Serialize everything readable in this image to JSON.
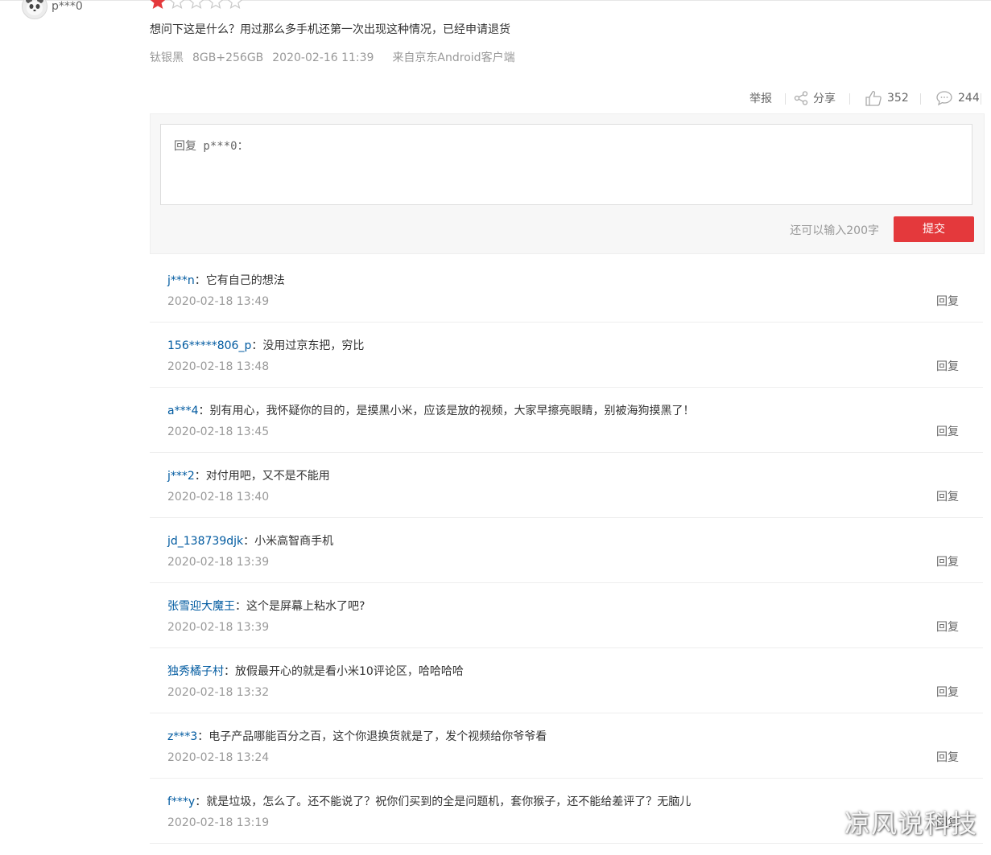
{
  "review": {
    "username": "p***0",
    "rating": 1,
    "rating_max": 5,
    "text": "想问下这是什么？用过那么多手机还第一次出现这种情况，已经申请退货",
    "meta": {
      "color": "钛银黑",
      "spec": "8GB+256GB",
      "datetime": "2020-02-16 11:39",
      "source": "来自京东Android客户端"
    }
  },
  "actions": {
    "report_label": "举报",
    "share_label": "分享",
    "like_count": "352",
    "comment_count": "244"
  },
  "reply_form": {
    "placeholder": "回复 p***0：",
    "char_count_text": "还可以输入200字",
    "submit_label": "提交"
  },
  "colors": {
    "accent_red": "#e4393c",
    "username_blue": "#005aa0",
    "text_gray": "#999999"
  },
  "comments": [
    {
      "user": "j***n",
      "text": "它有自己的想法",
      "time": "2020-02-18 13:49",
      "reply_label": "回复"
    },
    {
      "user": "156*****806_p",
      "text": "没用过京东把，穷比",
      "time": "2020-02-18 13:48",
      "reply_label": "回复"
    },
    {
      "user": "a***4",
      "text": "别有用心，我怀疑你的目的，是摸黑小米，应该是放的视频，大家早擦亮眼睛，别被海狗摸黑了！",
      "time": "2020-02-18 13:45",
      "reply_label": "回复"
    },
    {
      "user": "j***2",
      "text": "对付用吧，又不是不能用",
      "time": "2020-02-18 13:40",
      "reply_label": "回复"
    },
    {
      "user": "jd_138739djk",
      "text": "小米高智商手机",
      "time": "2020-02-18 13:39",
      "reply_label": "回复"
    },
    {
      "user": "张雪迎大魔王",
      "text": "这个是屏幕上粘水了吧?",
      "time": "2020-02-18 13:39",
      "reply_label": "回复"
    },
    {
      "user": "独秀橘子村",
      "text": "放假最开心的就是看小米10评论区，哈哈哈哈",
      "time": "2020-02-18 13:32",
      "reply_label": "回复"
    },
    {
      "user": "z***3",
      "text": "电子产品哪能百分之百，这个你退换货就是了，发个视频给你爷爷看",
      "time": "2020-02-18 13:24",
      "reply_label": "回复"
    },
    {
      "user": "f***y",
      "text": "就是垃圾，怎么了。还不能说了？祝你们买到的全是问题机，套你猴子，还不能给差评了？无脑儿",
      "time": "2020-02-18 13:19",
      "reply_label": "回复"
    }
  ],
  "watermark": "凉风说科技"
}
